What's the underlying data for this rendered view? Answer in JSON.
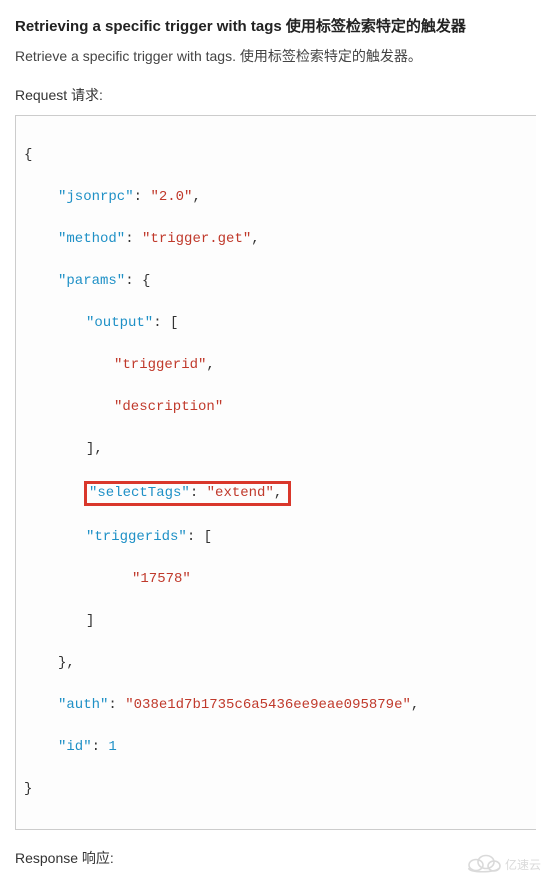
{
  "heading": "Retrieving a specific trigger with tags 使用标签检索特定的触发器",
  "description": "Retrieve a specific trigger with tags. 使用标签检索特定的触发器。",
  "request_label": "Request 请求:",
  "response_label": "Response 响应:",
  "code": {
    "open_brace": "{",
    "jsonrpc_key": "\"jsonrpc\"",
    "jsonrpc_val": "\"2.0\"",
    "method_key": "\"method\"",
    "method_val": "\"trigger.get\"",
    "params_key": "\"params\"",
    "output_key": "\"output\"",
    "output_v1": "\"triggerid\"",
    "output_v2": "\"description\"",
    "selectTags_key": "\"selectTags\"",
    "selectTags_val": "\"extend\"",
    "triggerids_key": "\"triggerids\"",
    "triggerids_v1": "\"17578\"",
    "auth_key": "\"auth\"",
    "auth_val": "\"038e1d7b1735c6a5436ee9eae095879e\"",
    "id_key": "\"id\"",
    "id_val": "1",
    "close_brace": "}",
    "open_obj": "{",
    "close_obj": "}",
    "open_arr": "[",
    "close_arr": "]",
    "colon": ":",
    "comma": ","
  },
  "watermark_text": "亿速云"
}
